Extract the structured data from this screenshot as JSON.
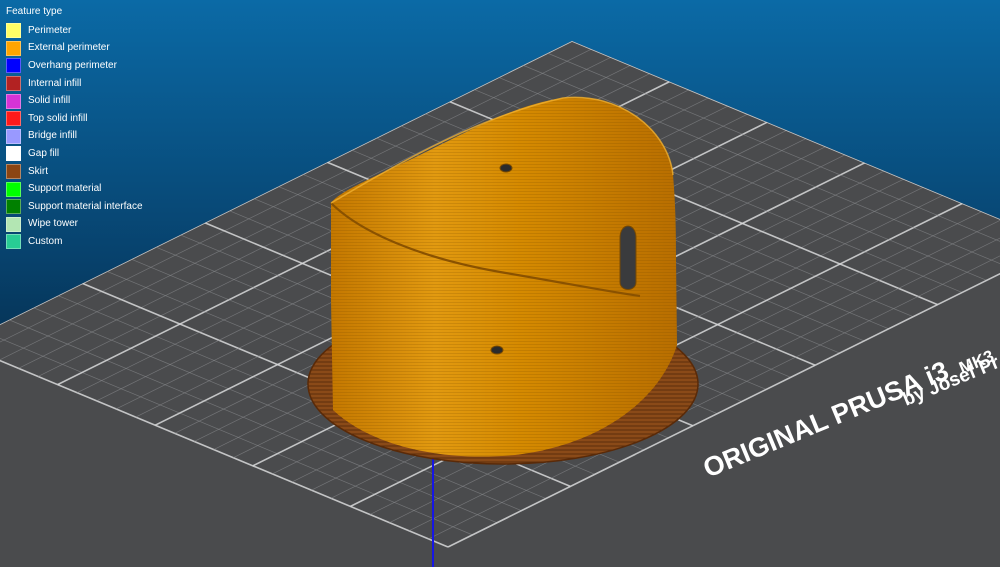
{
  "legend": {
    "title": "Feature type",
    "items": [
      {
        "label": "Perimeter",
        "color": "#ffff66"
      },
      {
        "label": "External perimeter",
        "color": "#ffa500"
      },
      {
        "label": "Overhang perimeter",
        "color": "#0000ff"
      },
      {
        "label": "Internal infill",
        "color": "#b22222"
      },
      {
        "label": "Solid infill",
        "color": "#d633d6"
      },
      {
        "label": "Top solid infill",
        "color": "#ff1a1a"
      },
      {
        "label": "Bridge infill",
        "color": "#9999ff"
      },
      {
        "label": "Gap fill",
        "color": "#ffffff"
      },
      {
        "label": "Skirt",
        "color": "#8b4513"
      },
      {
        "label": "Support material",
        "color": "#00ff00"
      },
      {
        "label": "Support material interface",
        "color": "#008000"
      },
      {
        "label": "Wipe tower",
        "color": "#b3e6b3"
      },
      {
        "label": "Custom",
        "color": "#28cc94"
      }
    ]
  },
  "bed": {
    "brand_line1": "ORIGINAL PRUSA i3",
    "model": "MK3",
    "brand_line2": "by Josef Pr"
  },
  "colors": {
    "background_top": "#0b6aa6",
    "background_bottom": "#030d1a",
    "bed_surface": "#4a4b4d",
    "grid_minor": "#8d8f92",
    "grid_major": "#d8d9da",
    "model_external_perimeter": "#d58a00",
    "skirt": "#8a4a18",
    "z_axis": "#1616e6"
  }
}
